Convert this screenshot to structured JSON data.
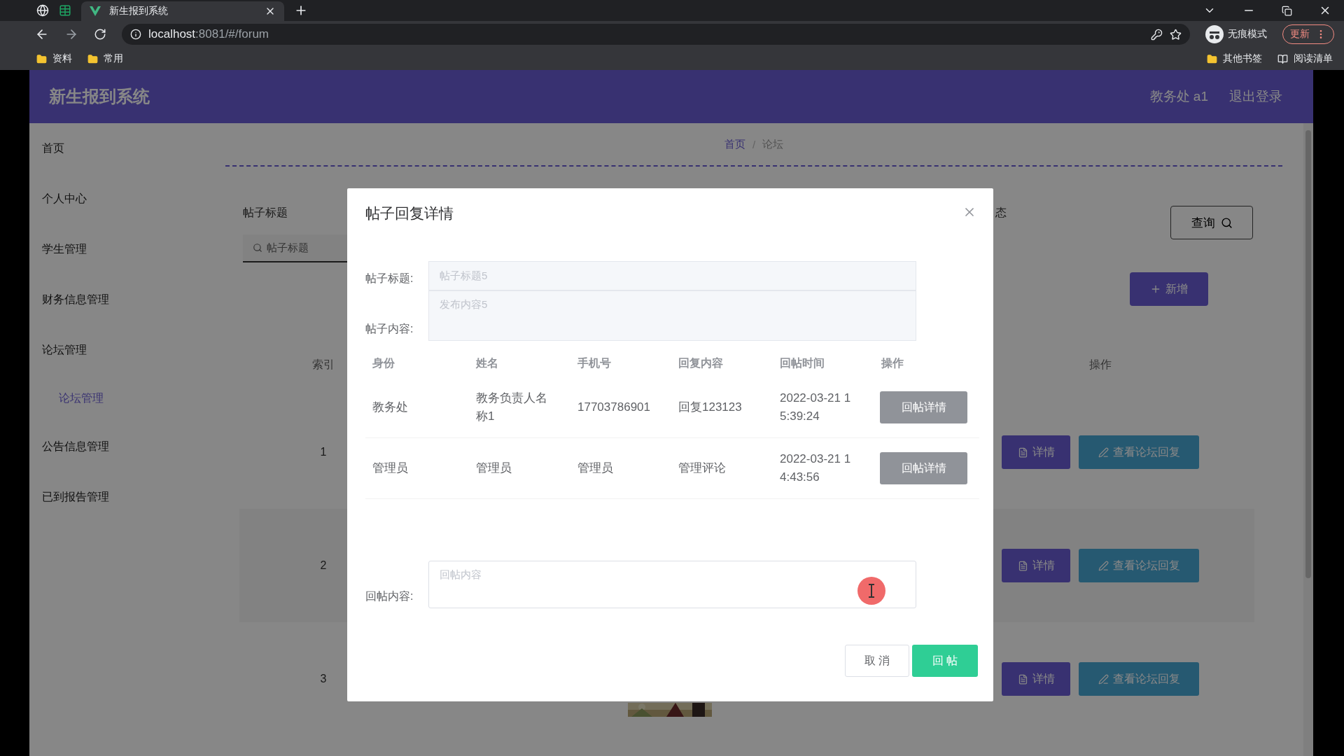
{
  "browser": {
    "tab_title": "新生报到系统",
    "url_host": "localhost",
    "url_rest": ":8081/#/forum",
    "incognito": "无痕模式",
    "update": "更新",
    "bookmarks": [
      "资料",
      "常用"
    ],
    "right_bookmarks": [
      "其他书签",
      "阅读清单"
    ]
  },
  "header": {
    "title": "新生报到系统",
    "user": "教务处 a1",
    "logout": "退出登录"
  },
  "sidebar": {
    "items": [
      {
        "label": "首页",
        "selected": false
      },
      {
        "label": "个人中心",
        "selected": false
      },
      {
        "label": "学生管理",
        "selected": false
      },
      {
        "label": "财务信息管理",
        "selected": false
      },
      {
        "label": "论坛管理",
        "selected": false,
        "children": [
          {
            "label": "论坛管理",
            "selected": true
          }
        ]
      },
      {
        "label": "公告信息管理",
        "selected": false
      },
      {
        "label": "已到报告管理",
        "selected": false
      }
    ]
  },
  "breadcrumb": {
    "items": [
      "首页",
      "论坛"
    ],
    "separator": "/"
  },
  "search": {
    "title_label": "帖子标题",
    "title_placeholder": "帖子标题",
    "status_label": "态",
    "query_button": "查询"
  },
  "add_button": "新增",
  "table": {
    "columns": [
      "索引",
      "操作"
    ],
    "rows": [
      {
        "index": "1",
        "detail": "详情",
        "replies": "查看论坛回复"
      },
      {
        "index": "2",
        "detail": "详情",
        "replies": "查看论坛回复"
      },
      {
        "index": "3",
        "detail": "详情",
        "replies": "查看论坛回复"
      }
    ]
  },
  "dialog": {
    "title": "帖子回复详情",
    "post_title_label": "帖子标题:",
    "post_title": "帖子标题5",
    "post_content_label": "帖子内容:",
    "post_content": "发布内容5",
    "columns": [
      "身份",
      "姓名",
      "手机号",
      "回复内容",
      "回帖时间",
      "操作"
    ],
    "rows": [
      {
        "role": "教务处",
        "name": "教务负责人名称1",
        "phone": "17703786901",
        "content": "回复123123",
        "time": "2022-03-21 15:39:24",
        "action": "回帖详情"
      },
      {
        "role": "管理员",
        "name": "管理员",
        "phone": "管理员",
        "content": "管理评论",
        "time": "2022-03-21 14:43:56",
        "action": "回帖详情"
      }
    ],
    "reply_label": "回帖内容:",
    "reply_placeholder": "回帖内容",
    "cancel": "取 消",
    "submit": "回 帖"
  }
}
